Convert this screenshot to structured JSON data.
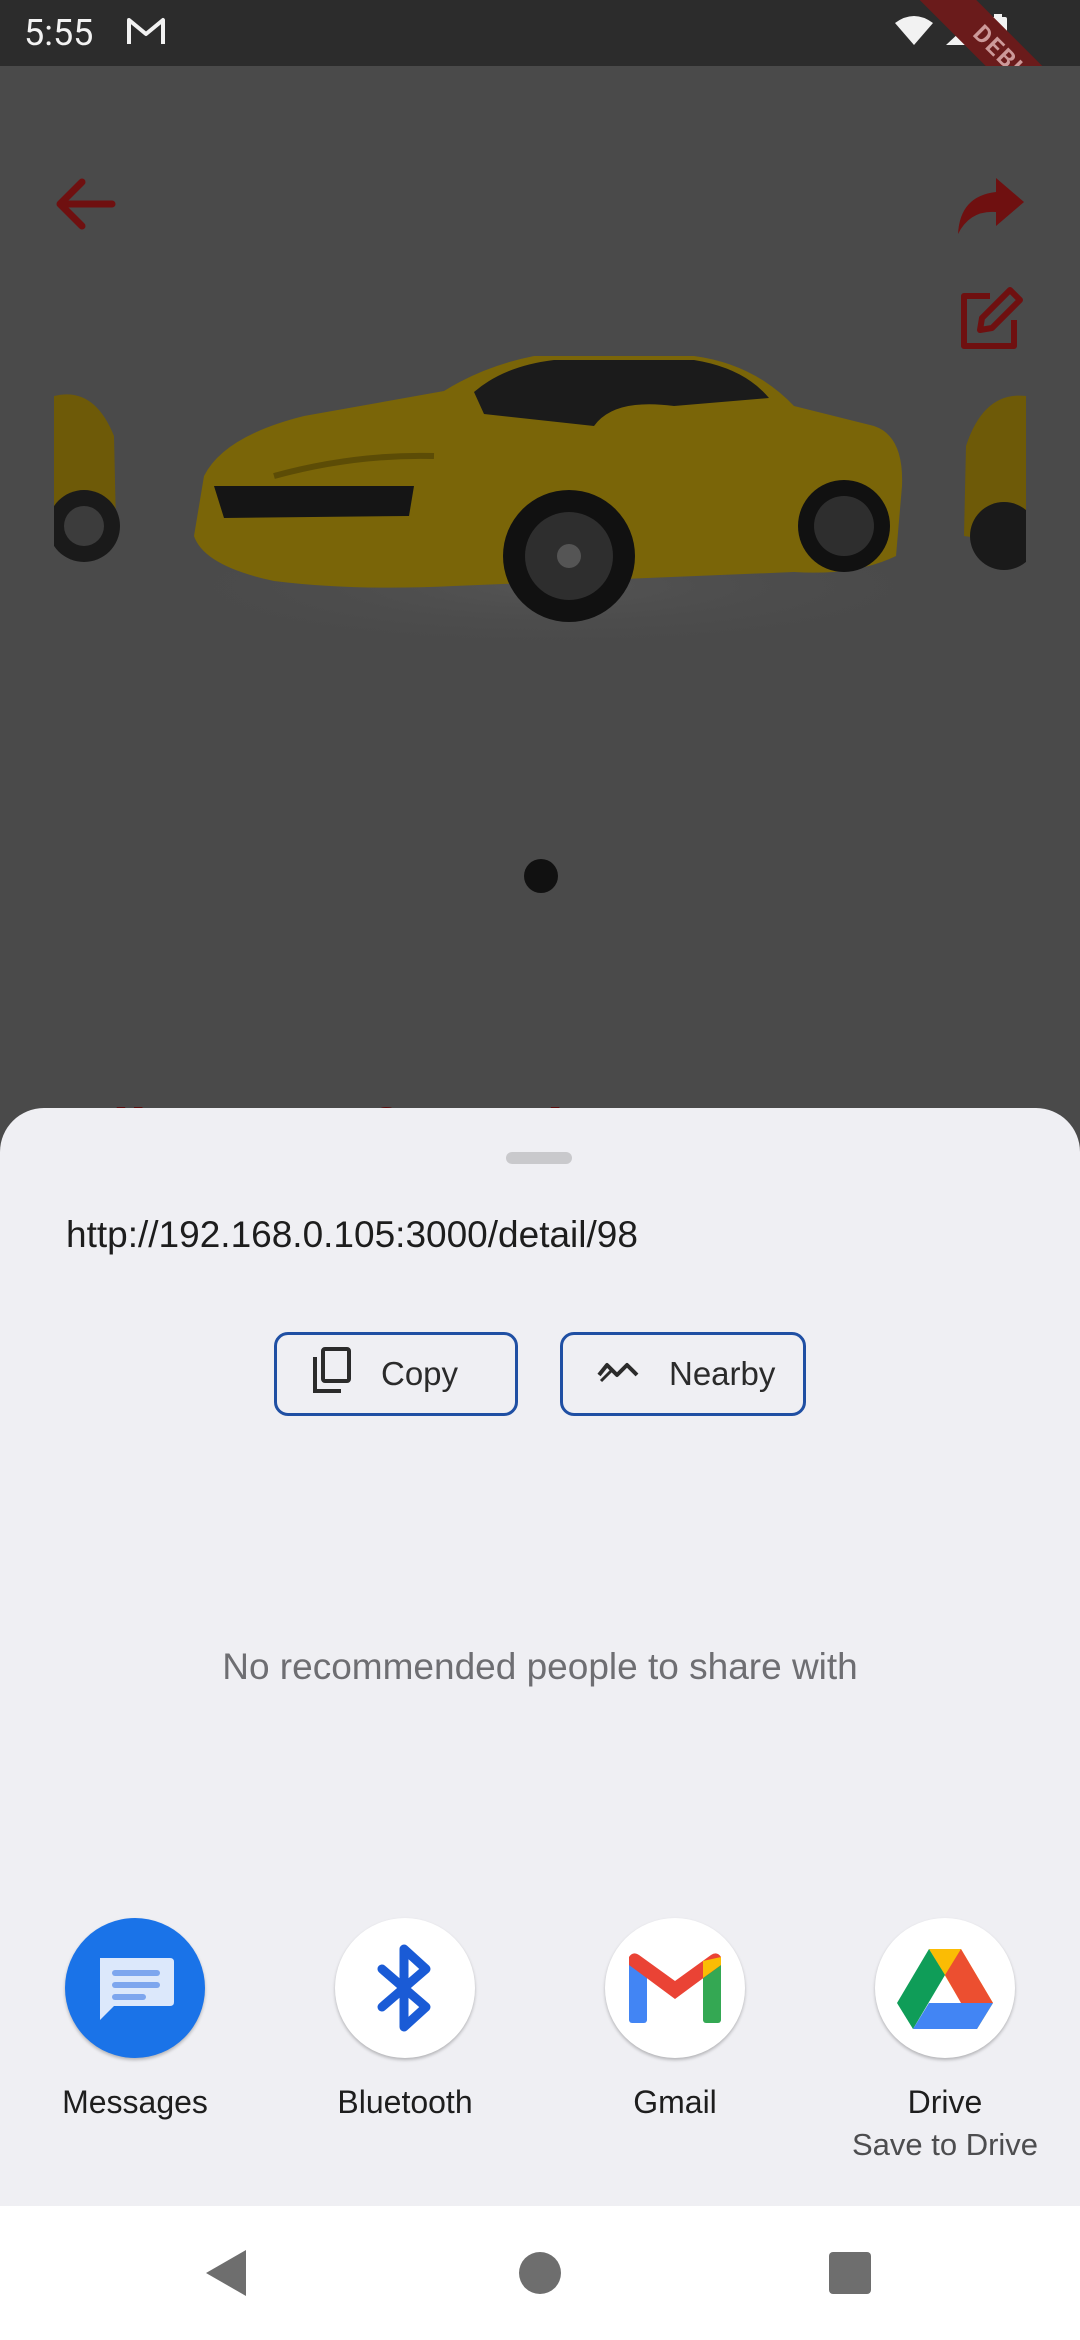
{
  "status_bar": {
    "time": "5:55",
    "notification_icon": "gmail-icon",
    "system_icons": [
      "wifi-icon",
      "signal-icon",
      "battery-icon"
    ],
    "debug_banner": "DEBUG"
  },
  "app": {
    "listing_title": "Yellow Car for Sale",
    "carousel_pages": 1,
    "toolbar_icons": [
      "back-arrow-icon",
      "share-icon",
      "edit-icon"
    ],
    "accent_color": "#8b1414"
  },
  "share_sheet": {
    "url": "http://192.168.0.105:3000/detail/98",
    "actions": {
      "copy_label": "Copy",
      "nearby_label": "Nearby"
    },
    "no_recommendations": "No recommended people to share with",
    "apps": [
      {
        "label": "Messages",
        "sub": "",
        "icon": "messages-icon"
      },
      {
        "label": "Bluetooth",
        "sub": "",
        "icon": "bluetooth-icon"
      },
      {
        "label": "Gmail",
        "sub": "",
        "icon": "gmail-icon"
      },
      {
        "label": "Drive",
        "sub": "Save to Drive",
        "icon": "drive-icon"
      }
    ]
  },
  "nav_bar": [
    "back-icon",
    "home-icon",
    "recents-icon"
  ]
}
